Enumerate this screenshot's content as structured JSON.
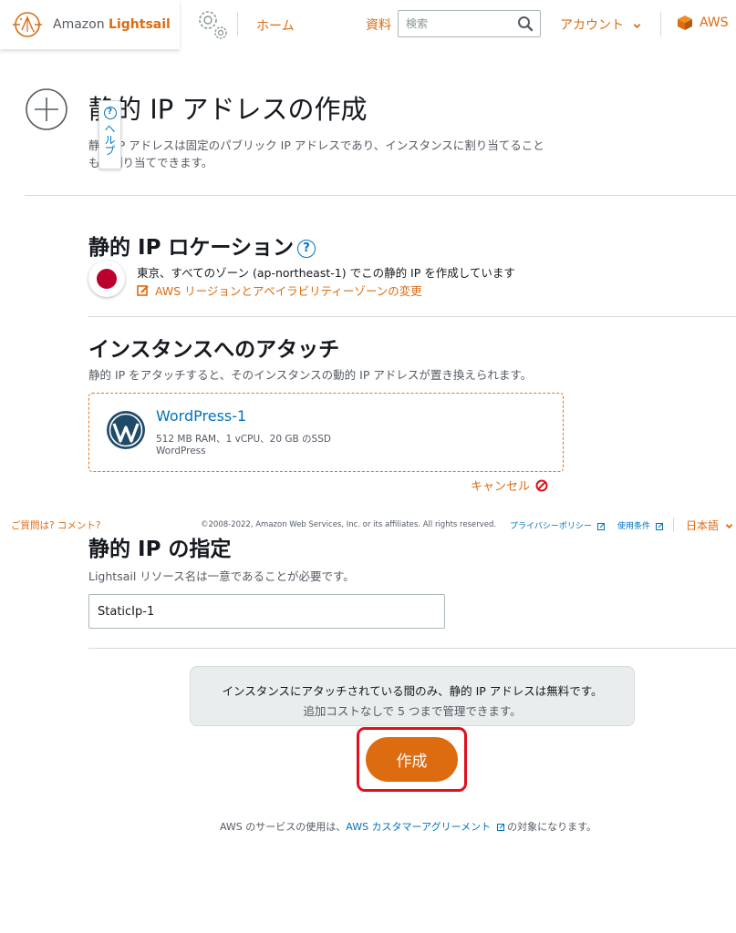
{
  "header": {
    "brand_prefix": "Amazon",
    "brand_name": "Lightsail",
    "home_label": "ホーム",
    "docs_label": "資料",
    "search_placeholder": "検索",
    "account_label": "アカウント",
    "aws_label": "AWS"
  },
  "page": {
    "title": "静的 IP アドレスの作成",
    "description": "静的 IP アドレスは固定のパブリック IP アドレスであり、インスタンスに割り当てることも再割り当てできます。",
    "help_label": "ヘルプ"
  },
  "location": {
    "title": "静的 IP ロケーション",
    "text": "東京、すべてのゾーン (ap-northeast-1) でこの静的 IP を作成しています",
    "change_link": "AWS リージョンとアベイラビリティーゾーンの変更"
  },
  "attach": {
    "title": "インスタンスへのアタッチ",
    "description": "静的 IP をアタッチすると、そのインスタンスの動的 IP アドレスが置き換えられます。",
    "instance_name": "WordPress-1",
    "instance_specs": "512 MB RAM、1 vCPU、20 GB のSSD",
    "instance_blueprint": "WordPress",
    "cancel_label": "キャンセル"
  },
  "footer": {
    "feedback": "ご質問は? コメント?",
    "copyright": "©2008-2022, Amazon Web Services, Inc. or its affiliates. All rights reserved.",
    "privacy": "プライバシーポリシー",
    "terms": "使用条件",
    "language": "日本語"
  },
  "naming": {
    "title": "静的 IP の指定",
    "description": "Lightsail リソース名は一意であることが必要です。",
    "value": "StaticIp-1"
  },
  "info": {
    "line1": "インスタンスにアタッチされている間のみ、静的 IP アドレスは無料です。",
    "line2": "追加コストなしで 5 つまで管理できます。"
  },
  "actions": {
    "create_label": "作成"
  },
  "agreement": {
    "prefix": "AWS のサービスの使用は、",
    "link": "AWS カスタマーアグリーメント",
    "suffix": " の対象になります。"
  },
  "colors": {
    "accent": "#dd6b10",
    "link": "#0073bb",
    "highlight": "#e0101e"
  }
}
